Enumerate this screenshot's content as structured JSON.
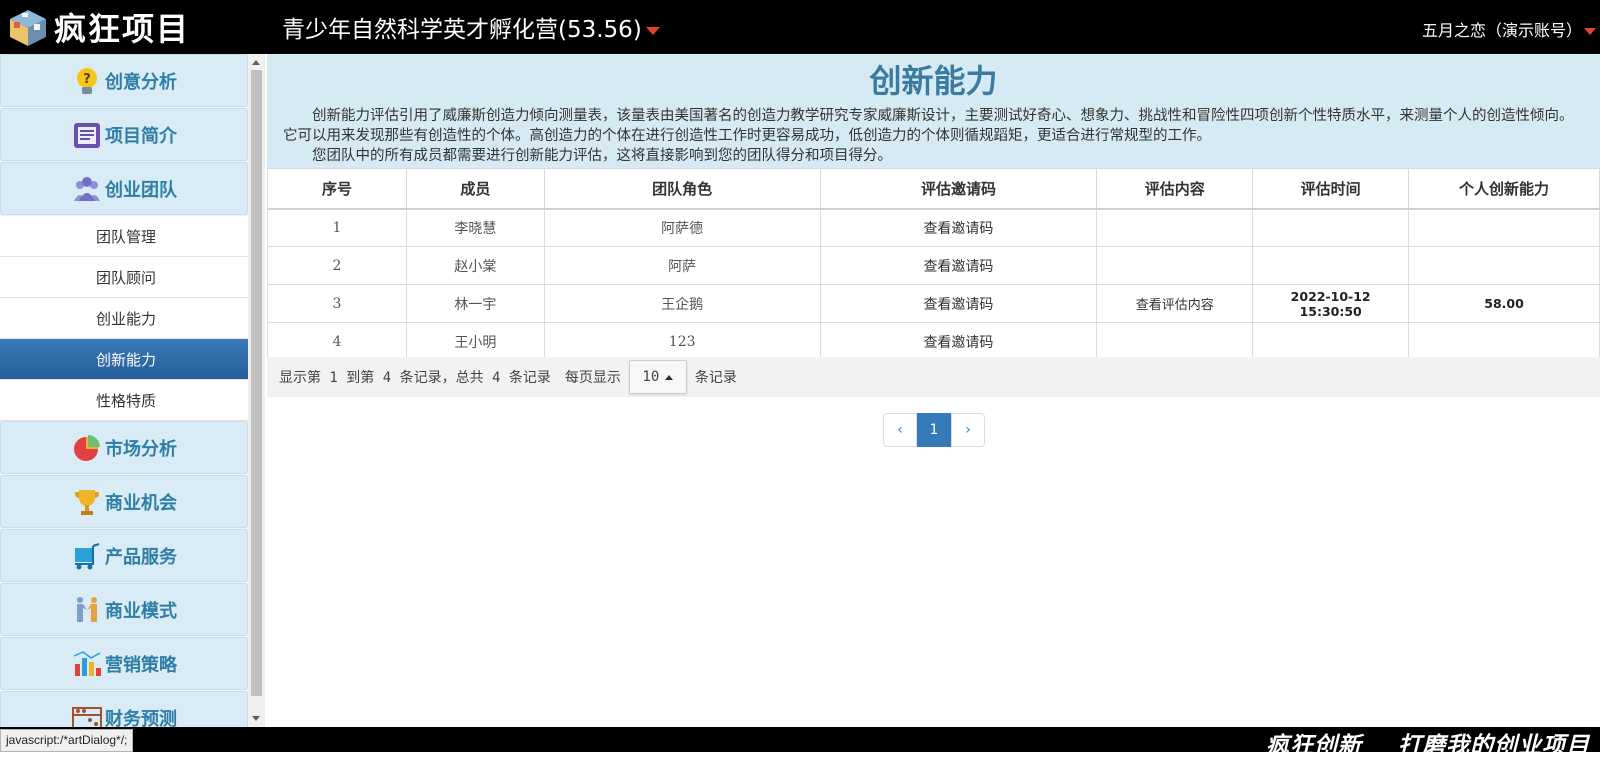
{
  "header": {
    "logo_text": "疯狂项目",
    "project_title": "青少年自然科学英才孵化营(53.56)",
    "user": "五月之恋（演示账号）"
  },
  "sidebar": {
    "items": [
      {
        "label": "创意分析",
        "icon": "lightbulb-question-icon"
      },
      {
        "label": "项目简介",
        "icon": "document-icon"
      },
      {
        "label": "创业团队",
        "icon": "team-icon"
      }
    ],
    "subitems": [
      {
        "label": "团队管理"
      },
      {
        "label": "团队顾问"
      },
      {
        "label": "创业能力"
      },
      {
        "label": "创新能力",
        "active": true
      },
      {
        "label": "性格特质"
      }
    ],
    "items_after": [
      {
        "label": "市场分析",
        "icon": "pie-chart-icon"
      },
      {
        "label": "商业机会",
        "icon": "trophy-icon"
      },
      {
        "label": "产品服务",
        "icon": "cart-icon"
      },
      {
        "label": "商业模式",
        "icon": "handshake-icon"
      },
      {
        "label": "营销策略",
        "icon": "bar-chart-icon"
      },
      {
        "label": "财务预测",
        "icon": "abacus-icon"
      }
    ]
  },
  "main": {
    "title": "创新能力",
    "desc1": "创新能力评估引用了威廉斯创造力倾向测量表，该量表由美国著名的创造力教学研究专家威廉斯设计，主要测试好奇心、想象力、挑战性和冒险性四项创新个性特质水平，来测量个人的创造性倾向。",
    "desc2": "它可以用来发现那些有创造性的个体。高创造力的个体在进行创造性工作时更容易成功，低创造力的个体则循规蹈矩，更适合进行常规型的工作。",
    "desc3": "您团队中的所有成员都需要进行创新能力评估，这将直接影响到您的团队得分和项目得分。"
  },
  "table": {
    "headers": [
      "序号",
      "成员",
      "团队角色",
      "评估邀请码",
      "评估内容",
      "评估时间",
      "个人创新能力"
    ],
    "rows": [
      {
        "no": "1",
        "member": "李晓慧",
        "role": "阿萨德",
        "code": "查看邀请码",
        "content": "",
        "date": "",
        "time": "",
        "score": ""
      },
      {
        "no": "2",
        "member": "赵小棠",
        "role": "阿萨",
        "code": "查看邀请码",
        "content": "",
        "date": "",
        "time": "",
        "score": ""
      },
      {
        "no": "3",
        "member": "林一宇",
        "role": "王企鹅",
        "code": "查看邀请码",
        "content": "查看评估内容",
        "date": "2022-10-12",
        "time": "15:30:50",
        "score": "58.00"
      },
      {
        "no": "4",
        "member": "王小明",
        "role": "123",
        "code": "查看邀请码",
        "content": "",
        "date": "",
        "time": "",
        "score": ""
      }
    ]
  },
  "pager": {
    "info": "显示第 1 到第 4 条记录，总共 4 条记录",
    "per_page_prefix": "每页显示",
    "per_page_value": "10",
    "per_page_suffix": "条记录",
    "prev": "‹",
    "current": "1",
    "next": "›"
  },
  "footer": {
    "slogan": "疯狂创新    打磨我的创业项目"
  },
  "status": {
    "tip": "javascript:/*artDialog*/;"
  },
  "colors": {
    "accent": "#2f7ea5",
    "active_nav": "#2d6aa8",
    "header_bg": "#000000",
    "pager_current": "#337ab7"
  }
}
